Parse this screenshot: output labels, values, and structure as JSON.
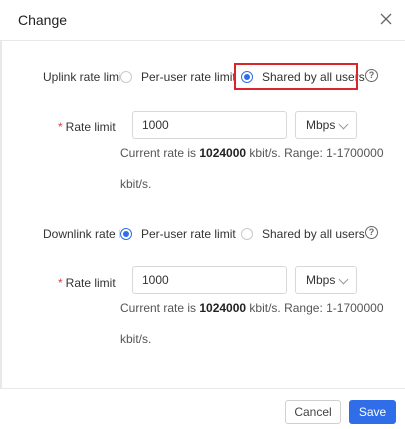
{
  "dialog": {
    "title": "Change"
  },
  "uplink": {
    "label": "Uplink rate limit",
    "options": [
      {
        "label": "Per-user rate limit",
        "selected": false
      },
      {
        "label": "Shared by all users",
        "selected": true
      }
    ],
    "rate_label": "Rate limit",
    "rate_value": "1000",
    "unit": "Mbps",
    "hint_prefix": "Current rate is ",
    "hint_rate": "1024000",
    "hint_suffix": " kbit/s. Range: 1-1700000",
    "hint_line2": "kbit/s."
  },
  "downlink": {
    "label": "Downlink rate limit",
    "options": [
      {
        "label": "Per-user rate limit",
        "selected": true
      },
      {
        "label": "Shared by all users",
        "selected": false
      }
    ],
    "rate_label": "Rate limit",
    "rate_value": "1000",
    "unit": "Mbps",
    "hint_prefix": "Current rate is ",
    "hint_rate": "1024000",
    "hint_suffix": " kbit/s. Range: 1-1700000",
    "hint_line2": "kbit/s."
  },
  "footer": {
    "cancel_label": "Cancel",
    "save_label": "Save"
  },
  "colors": {
    "accent": "#2f6ee8",
    "highlight": "#d9262c",
    "required": "#e23b3b"
  },
  "icons": {
    "close": "close-icon",
    "help": "question-circle-icon",
    "dropdown": "chevron-down-icon"
  }
}
